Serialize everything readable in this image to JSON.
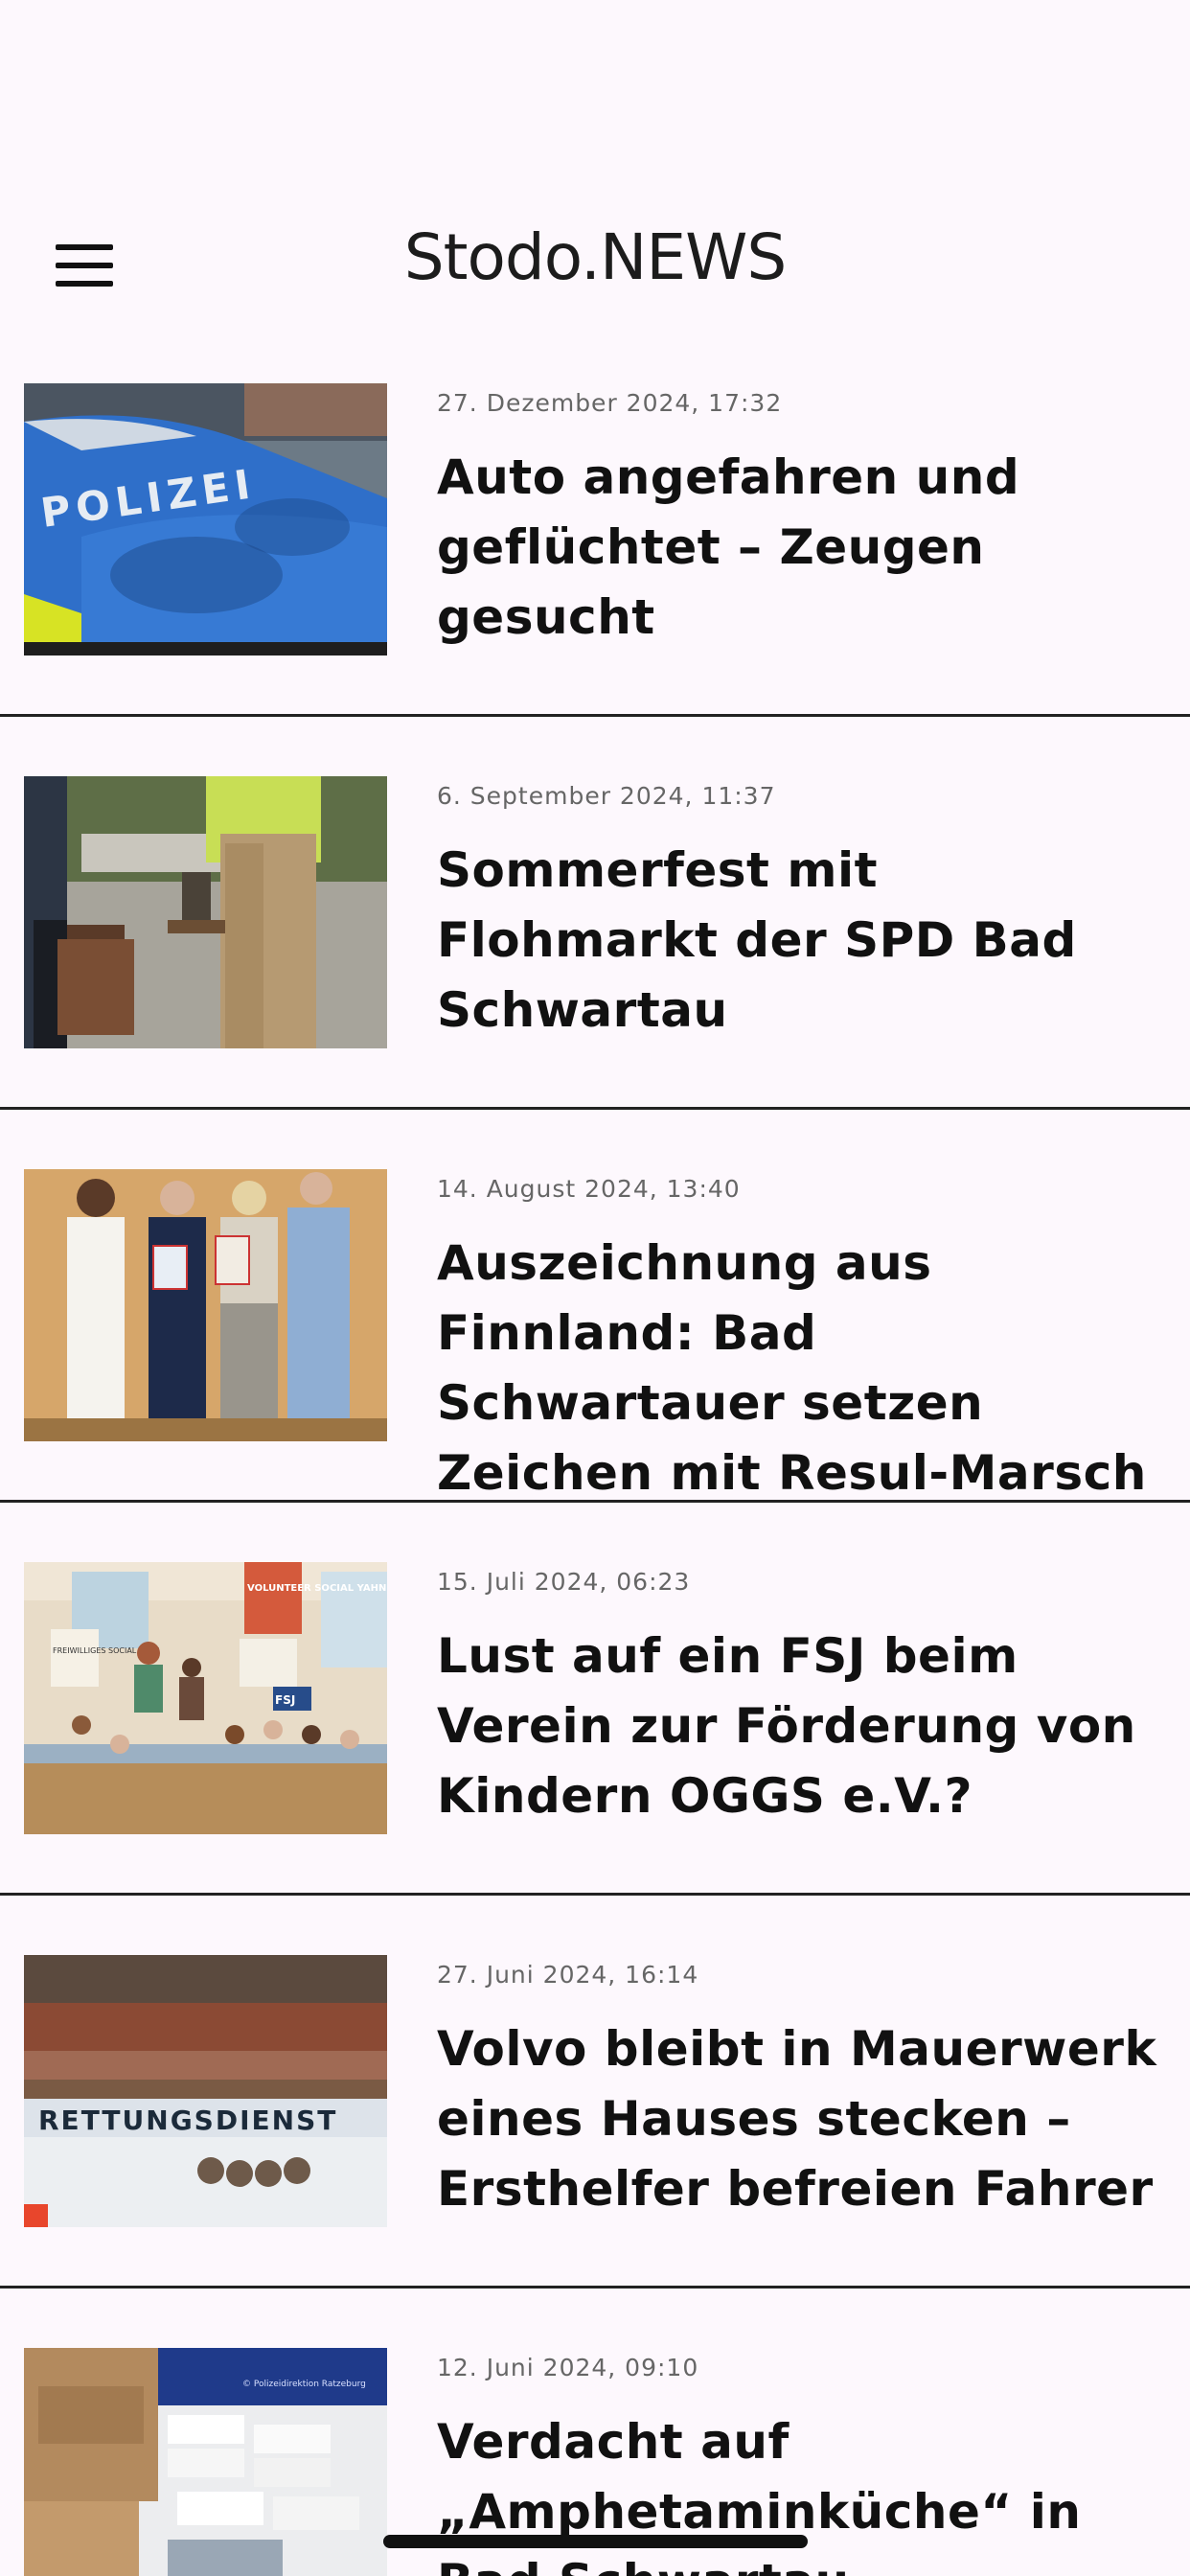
{
  "header": {
    "title": "Stodo.NEWS",
    "menu_icon": "hamburger-menu-icon"
  },
  "articles": [
    {
      "date": "27. Dezember 2024, 17:32",
      "title": "Auto angefahren und geflüchtet – Zeugen gesucht",
      "image": "police-car-photo"
    },
    {
      "date": "6. September 2024, 11:37",
      "title": "Sommerfest mit Flohmarkt der SPD Bad Schwartau",
      "image": "people-carrying-boxes-photo"
    },
    {
      "date": "14. August 2024, 13:40",
      "title": "Auszeichnung aus Finnland: Bad Schwartauer setzen Zeichen mit Resul-Marsch",
      "image": "award-ceremony-photo"
    },
    {
      "date": "15. Juli 2024, 06:23",
      "title": "Lust auf ein FSJ beim Verein zur Förderung von Kindern OGGS e.V.?",
      "image": "classroom-photo",
      "image_text": [
        "VOLUNTEER SOCIAL YAHN FSJ",
        "FREIWILLIGES SOCIAL YAHN",
        "FSJ"
      ]
    },
    {
      "date": "27. Juni 2024, 16:14",
      "title": "Volvo bleibt in Mauerwerk eines Hauses stecken – Ersthelfer befreien Fahrer",
      "image": "rettungsdienst-vehicle-photo",
      "image_text": [
        "RETTUNGSDIENST"
      ]
    },
    {
      "date": "12. Juni 2024, 09:10",
      "title": "Verdacht auf „Amphetaminküche“ in Bad Schwartau",
      "image": "seized-drugs-photo",
      "image_text": [
        "© Polizeidirektion Ratzeburg"
      ]
    }
  ],
  "colors": {
    "background": "#fdf8fd",
    "divider": "#222222",
    "date": "#666666"
  }
}
